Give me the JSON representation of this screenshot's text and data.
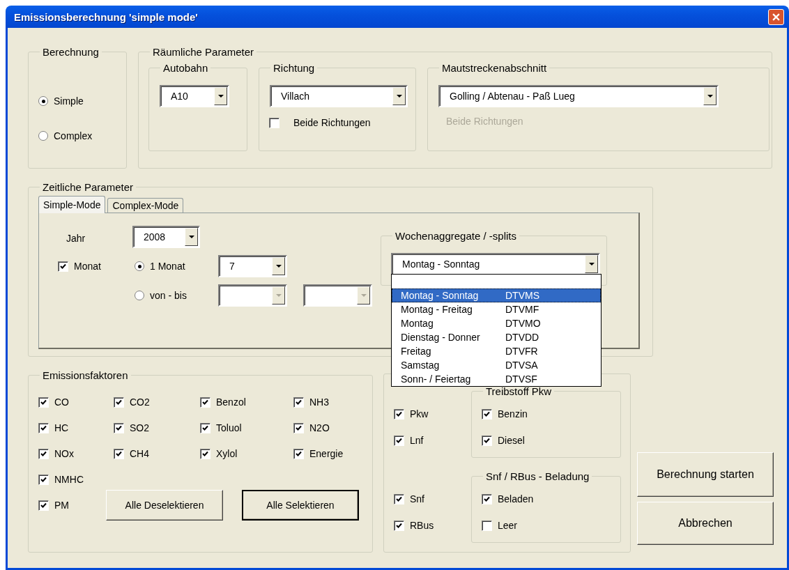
{
  "window": {
    "title": "Emissionsberechnung 'simple mode'"
  },
  "berechnung": {
    "title": "Berechnung",
    "options": [
      {
        "label": "Simple",
        "selected": true
      },
      {
        "label": "Complex",
        "selected": false
      }
    ]
  },
  "raeumliche_parameter": {
    "title": "Räumliche Parameter",
    "autobahn": {
      "title": "Autobahn",
      "value": "A10"
    },
    "richtung": {
      "title": "Richtung",
      "value": "Villach",
      "both": {
        "label": "Beide Richtungen",
        "checked": false
      }
    },
    "mautstreckenabschnitt": {
      "title": "Mautstreckenabschnitt",
      "value": "Golling / Abtenau - Paß Lueg",
      "both": {
        "label": "Beide Richtungen",
        "disabled": true
      }
    }
  },
  "zeitliche_parameter": {
    "title": "Zeitliche Parameter",
    "tabs": [
      {
        "label": "Simple-Mode",
        "selected": true
      },
      {
        "label": "Complex-Mode",
        "selected": false
      }
    ],
    "jahr": {
      "label": "Jahr",
      "value": "2008"
    },
    "monat": {
      "label": "Monat",
      "checked": true
    },
    "modes": [
      {
        "label": "1 Monat",
        "selected": true,
        "fields": [
          {
            "value": "7",
            "disabled": false
          }
        ]
      },
      {
        "label": "von - bis",
        "selected": false,
        "fields": [
          {
            "disabled": true
          },
          {
            "disabled": true
          }
        ]
      }
    ],
    "wochen": {
      "title": "Wochenaggregate / -splits",
      "value": "Montag - Sonntag",
      "expanded": true,
      "options": [
        {
          "name": "Montag - Sonntag",
          "code": "DTVMS",
          "selected": true
        },
        {
          "name": "Montag - Freitag",
          "code": "DTVMF",
          "selected": false
        },
        {
          "name": "Montag",
          "code": "DTVMO",
          "selected": false
        },
        {
          "name": "Dienstag - Donner",
          "code": "DTVDD",
          "selected": false
        },
        {
          "name": "Freitag",
          "code": "DTVFR",
          "selected": false
        },
        {
          "name": "Samstag",
          "code": "DTVSA",
          "selected": false
        },
        {
          "name": "Sonn- / Feiertag",
          "code": "DTVSF",
          "selected": false
        }
      ]
    }
  },
  "emissionsfaktoren": {
    "title": "Emissionsfaktoren",
    "columns": [
      [
        {
          "label": "CO",
          "checked": true
        },
        {
          "label": "HC",
          "checked": true
        },
        {
          "label": "NOx",
          "checked": true
        },
        {
          "label": "NMHC",
          "checked": true
        },
        {
          "label": "PM",
          "checked": true
        }
      ],
      [
        {
          "label": "CO2",
          "checked": true
        },
        {
          "label": "SO2",
          "checked": true
        },
        {
          "label": "CH4",
          "checked": true
        }
      ],
      [
        {
          "label": "Benzol",
          "checked": true
        },
        {
          "label": "Toluol",
          "checked": true
        },
        {
          "label": "Xylol",
          "checked": true
        }
      ],
      [
        {
          "label": "NH3",
          "checked": true
        },
        {
          "label": "N2O",
          "checked": true
        },
        {
          "label": "Energie",
          "checked": true
        }
      ]
    ],
    "buttons": [
      {
        "label": "Alle Deselektieren",
        "default": false
      },
      {
        "label": "Alle Selektieren",
        "default": true
      }
    ]
  },
  "fahrzeuge": {
    "rows": [
      {
        "vehicles": [
          {
            "label": "Pkw",
            "checked": true
          },
          {
            "label": "Lnf",
            "checked": true
          }
        ],
        "subgroup": {
          "title": "Treibstoff Pkw",
          "items": [
            {
              "label": "Benzin",
              "checked": true
            },
            {
              "label": "Diesel",
              "checked": true
            }
          ]
        }
      },
      {
        "vehicles": [
          {
            "label": "Snf",
            "checked": true
          },
          {
            "label": "RBus",
            "checked": true
          }
        ],
        "subgroup": {
          "title": "Snf / RBus - Beladung",
          "items": [
            {
              "label": "Beladen",
              "checked": true
            },
            {
              "label": "Leer",
              "checked": false
            }
          ]
        }
      }
    ]
  },
  "actions": [
    {
      "label": "Berechnung starten"
    },
    {
      "label": "Abbrechen"
    }
  ]
}
